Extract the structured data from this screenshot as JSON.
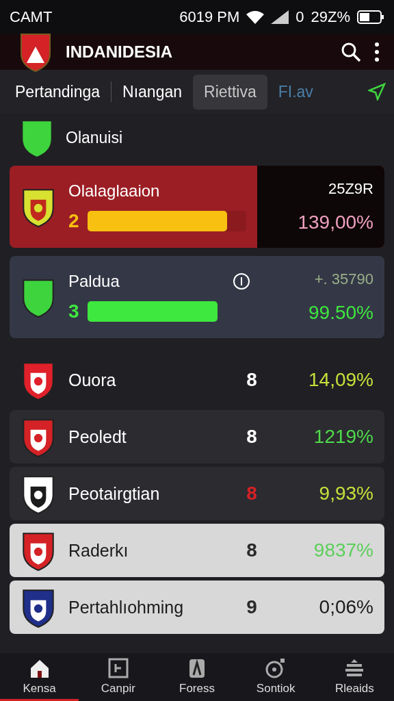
{
  "status_bar": {
    "carrier": "CAMT",
    "time": "6019 PM",
    "sim": "0",
    "battery": "29Z%"
  },
  "app_bar": {
    "title": "INDANIDESIA"
  },
  "tabs": [
    {
      "label": "Pertandinga",
      "selected": false
    },
    {
      "label": "Nıangan",
      "selected": false
    },
    {
      "label": "Riettiva",
      "selected": true
    },
    {
      "label": "FI.av",
      "selected": false
    }
  ],
  "section": {
    "title": "Olanuisi"
  },
  "featured": [
    {
      "name": "Olalaglaaion",
      "rank": "2",
      "level": 0.88,
      "stat": "25Z9R",
      "percent": "139,00%",
      "kind": "red",
      "info": false
    },
    {
      "name": "Paldua",
      "rank": "3",
      "level": 0.82,
      "stat": "+. 35790",
      "percent": "99.50%",
      "kind": "slate",
      "info": true
    }
  ],
  "rows": [
    {
      "name": "Ouora",
      "rank": "8",
      "percent": "14,09%",
      "color": "#c8e03a",
      "card": false,
      "light": false,
      "rank_alert": false
    },
    {
      "name": "Peoledt",
      "rank": "8",
      "percent": "1219%",
      "color": "#4fdc4a",
      "card": true,
      "light": false,
      "rank_alert": false
    },
    {
      "name": "Peotairgtian",
      "rank": "8",
      "percent": "9,93%",
      "color": "#c8e03a",
      "card": true,
      "light": false,
      "rank_alert": true
    },
    {
      "name": "Raderkı",
      "rank": "8",
      "percent": "9837%",
      "color": "#5ccf5a",
      "card": true,
      "light": true,
      "rank_alert": false
    },
    {
      "name": "Pertahlıohming",
      "rank": "9",
      "percent": "0;06%",
      "color": "#1a1a1a",
      "card": true,
      "light": true,
      "rank_alert": false
    }
  ],
  "nav": [
    {
      "label": "Kensa",
      "selected": true
    },
    {
      "label": "Canpir",
      "selected": false
    },
    {
      "label": "Foress",
      "selected": false
    },
    {
      "label": "Sontiok",
      "selected": false
    },
    {
      "label": "Rleaids",
      "selected": false
    }
  ]
}
